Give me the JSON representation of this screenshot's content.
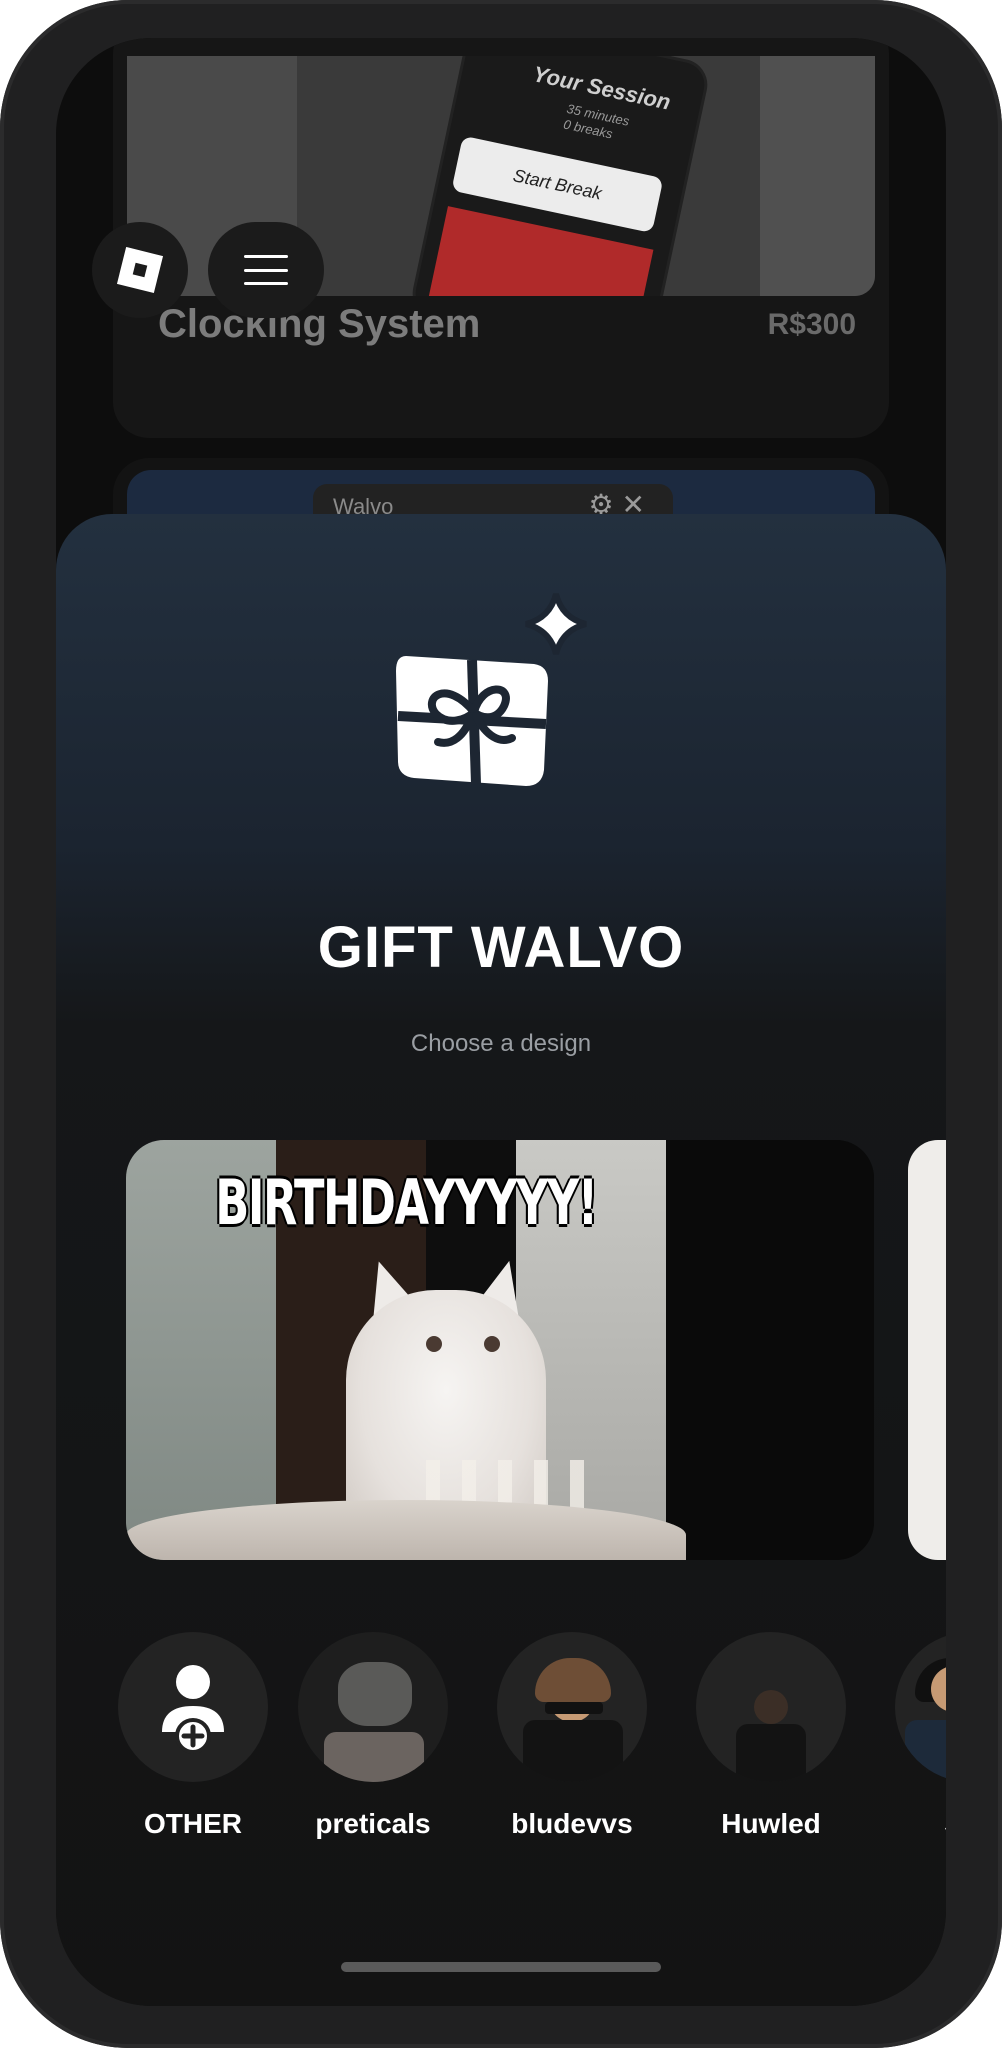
{
  "background": {
    "product": {
      "mock_title": "Your Session",
      "mock_sub": "35 minutes\n0 breaks",
      "mock_button": "Start Break",
      "title": "Clocking System",
      "price": "R$300"
    },
    "window": {
      "title": "Walvo",
      "icons": "⚙✕"
    }
  },
  "header": {
    "logo_icon": "roblox-logo-icon",
    "menu_icon": "hamburger-menu-icon"
  },
  "modal": {
    "icon": "gift-sparkle-icon",
    "title": "GIFT WALVO",
    "subtitle": "Choose a design",
    "designs": [
      {
        "caption": "BIRTHDAYYYYY!"
      }
    ]
  },
  "recipients": [
    {
      "name": "OTHER",
      "icon": "add-user-icon"
    },
    {
      "name": "preticals"
    },
    {
      "name": "bludevvs"
    },
    {
      "name": "Huwled"
    },
    {
      "name": "Seb"
    }
  ],
  "colors": {
    "modal_top": "#23303f",
    "modal_bottom": "#131313",
    "text_primary": "#ffffff",
    "text_secondary": "#9a9ea3"
  }
}
